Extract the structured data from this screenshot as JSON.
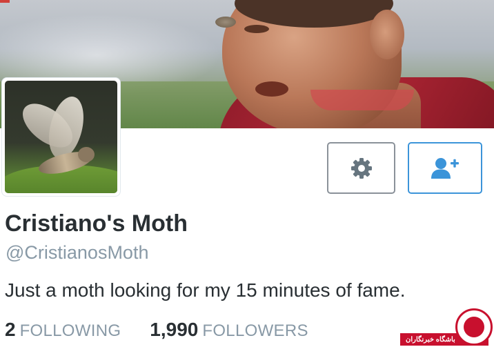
{
  "profile": {
    "name": "Cristiano's Moth",
    "handle": "@CristianosMoth",
    "bio": "Just a moth looking for my 15 minutes of fame."
  },
  "stats": {
    "following": {
      "count": "2",
      "label": "FOLLOWING"
    },
    "followers": {
      "count": "1,990",
      "label": "FOLLOWERS"
    }
  },
  "actions": {
    "settings_icon": "gear-icon",
    "follow_icon": "add-user-icon"
  },
  "watermark": {
    "text": "باشگاه خبرنگاران"
  },
  "colors": {
    "follow_accent": "#3b94d9",
    "text_primary": "#292f33",
    "text_secondary": "#8899a6",
    "watermark_red": "#c8102e"
  }
}
